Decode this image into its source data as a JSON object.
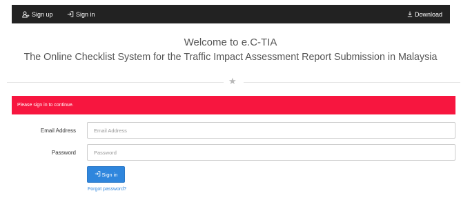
{
  "navbar": {
    "signup": {
      "label": "Sign up",
      "icon": "add-user-icon"
    },
    "signin": {
      "label": "Sign in",
      "icon": "sign-in-icon"
    },
    "download": {
      "label": "Download",
      "icon": "download-icon"
    }
  },
  "header": {
    "welcome": "Welcome to e.C-TIA",
    "subtitle": "The Online Checklist System for the Traffic Impact Assessment Report Submission in Malaysia"
  },
  "divider": {
    "glyph": "★"
  },
  "alert": {
    "message": "Please sign in to continue.",
    "color": "#f7163f"
  },
  "form": {
    "email": {
      "label": "Email Address",
      "placeholder": "Email Address",
      "value": ""
    },
    "password": {
      "label": "Password",
      "placeholder": "Password",
      "value": ""
    },
    "submit": {
      "label": "Sign in",
      "icon": "sign-in-icon",
      "color": "#2f86dd"
    },
    "forgot": {
      "label": "Forgot password?"
    }
  },
  "colors": {
    "navbar_bg": "#222222",
    "accent": "#2f86dd",
    "alert": "#f7163f"
  }
}
